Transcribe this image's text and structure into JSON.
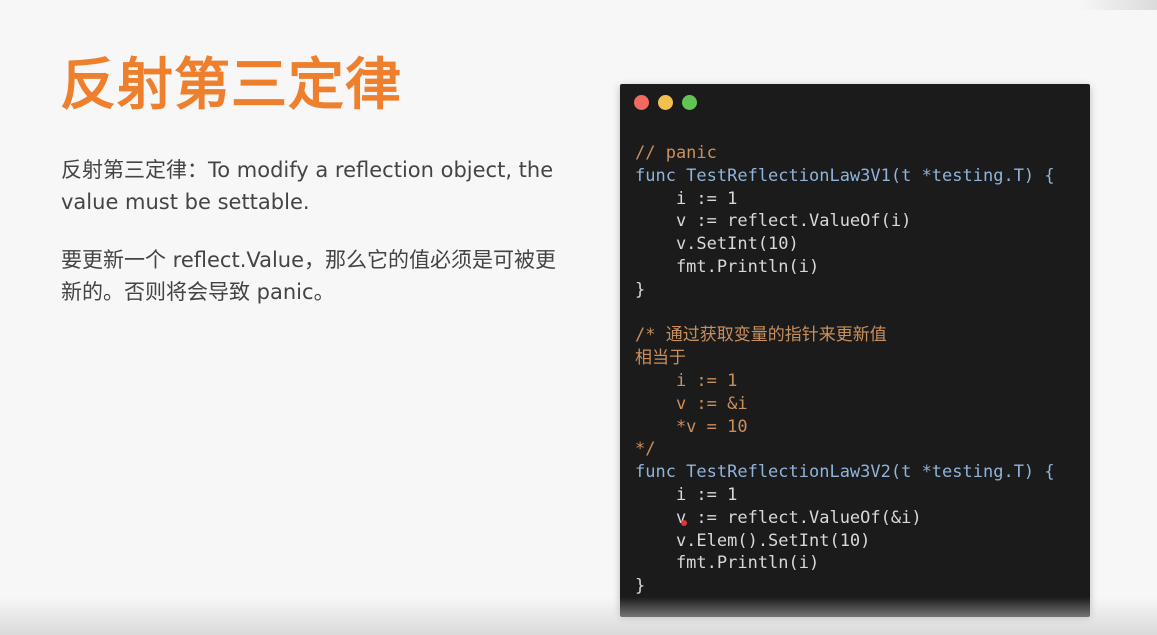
{
  "slide": {
    "title": "反射第三定律",
    "paragraph1": "反射第三定律：To modify a reflection object, the value must be settable.",
    "paragraph2": "要更新一个 reflect.Value，那么它的值必须是可被更新的。否则将会导致 panic。"
  },
  "code": {
    "lines": [
      "// panic",
      "func TestReflectionLaw3V1(t *testing.T) {",
      "    i := 1",
      "    v := reflect.ValueOf(i)",
      "    v.SetInt(10)",
      "    fmt.Println(i)",
      "}",
      "",
      "/* 通过获取变量的指针来更新值",
      "相当于",
      "    i := 1",
      "    v := &i",
      "    *v = 10",
      "*/",
      "func TestReflectionLaw3V2(t *testing.T) {",
      "    i := 1",
      "    v := reflect.ValueOf(&i)",
      "    v.Elem().SetInt(10)",
      "    fmt.Println(i)",
      "}"
    ]
  },
  "colors": {
    "title": "#ee7f2d",
    "comment": "#c9905e",
    "keyword": "#8fb3d9",
    "number": "#c5a3e0",
    "code_bg": "#1b1b1b"
  },
  "icons": [
    "close-dot-icon",
    "minimize-dot-icon",
    "maximize-dot-icon"
  ]
}
